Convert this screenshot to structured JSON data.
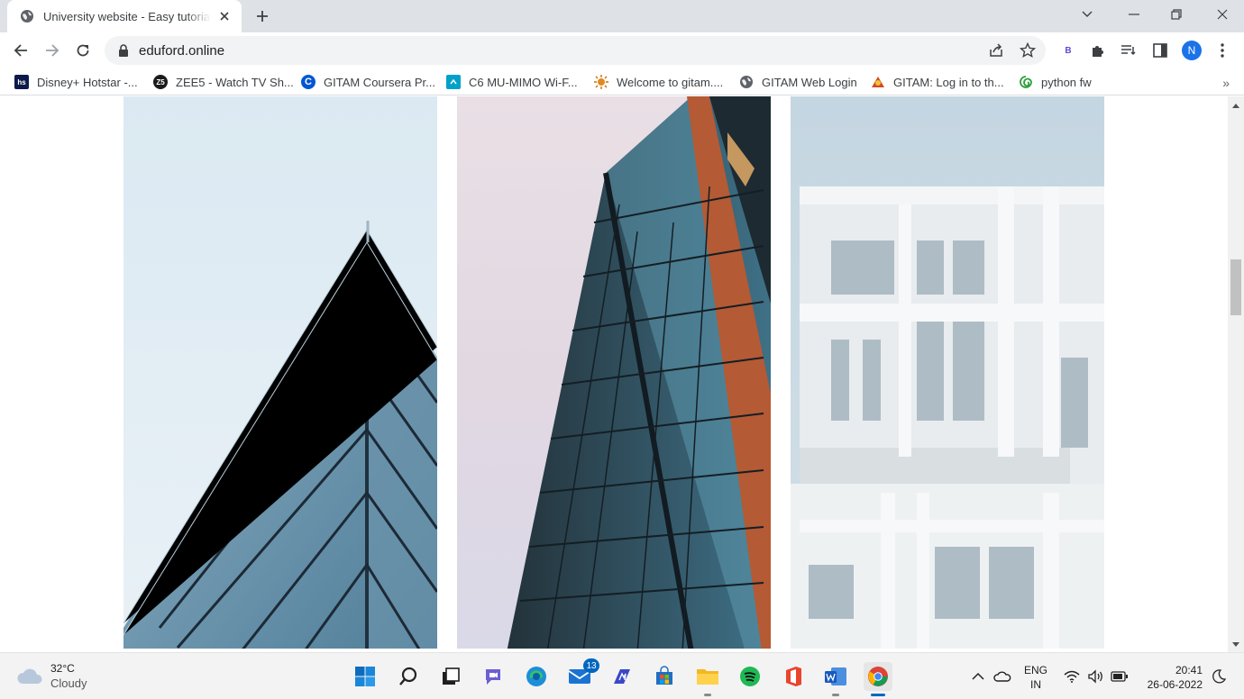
{
  "browser": {
    "tab": {
      "title": "University website - Easy tutorials"
    },
    "url": "eduford.online",
    "profile_initial": "N",
    "extension_letter": "B"
  },
  "bookmarks": [
    {
      "label": "Disney+ Hotstar -...",
      "icon": "hotstar-icon",
      "icon_text": "hs",
      "color": "#0c1a4b"
    },
    {
      "label": "ZEE5 - Watch TV Sh...",
      "icon": "zee5-icon",
      "icon_text": "Z5",
      "color": "#1b1b1b"
    },
    {
      "label": "GITAM Coursera Pr...",
      "icon": "coursera-icon",
      "icon_text": "C",
      "color": "#0056d2"
    },
    {
      "label": "C6 MU-MIMO Wi-F...",
      "icon": "router-icon",
      "icon_text": "",
      "color": "#00a1c9"
    },
    {
      "label": "Welcome to gitam....",
      "icon": "gitam-sun-icon",
      "icon_text": "",
      "color": "#e08a1e"
    },
    {
      "label": "GITAM Web Login",
      "icon": "globe-icon",
      "icon_text": "",
      "color": "#5f6368"
    },
    {
      "label": "GITAM: Log in to th...",
      "icon": "gitam-logo-icon",
      "icon_text": "",
      "color": "#d44a1c"
    },
    {
      "label": "python fw",
      "icon": "python-fw-icon",
      "icon_text": "",
      "color": "#2e9e3e"
    }
  ],
  "page": {
    "gallery": [
      "pyramid-glass-building",
      "angled-glass-tower",
      "white-concrete-building"
    ]
  },
  "taskbar": {
    "weather": {
      "temp": "32°C",
      "condition": "Cloudy"
    },
    "mail_badge": "13",
    "language": {
      "line1": "ENG",
      "line2": "IN"
    },
    "clock": {
      "time": "20:41",
      "date": "26-06-2022"
    }
  }
}
